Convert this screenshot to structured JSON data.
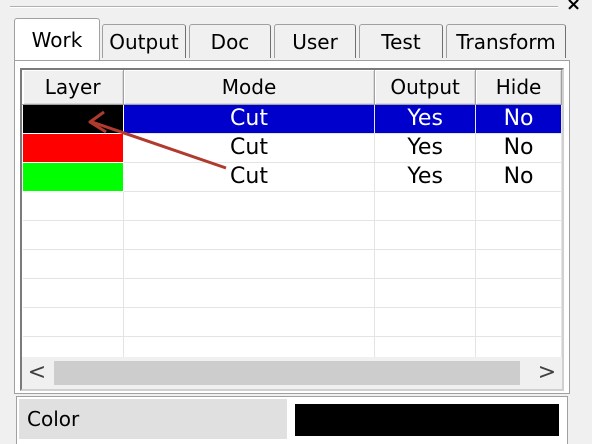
{
  "window": {
    "close_glyph": "×"
  },
  "tabs": [
    {
      "label": "Work",
      "active": true
    },
    {
      "label": "Output",
      "active": false
    },
    {
      "label": "Doc",
      "active": false
    },
    {
      "label": "User",
      "active": false
    },
    {
      "label": "Test",
      "active": false
    },
    {
      "label": "Transform",
      "active": false
    }
  ],
  "layers_table": {
    "headers": {
      "layer": "Layer",
      "mode": "Mode",
      "output": "Output",
      "hide": "Hide"
    },
    "rows": [
      {
        "color": "#000000",
        "mode": "Cut",
        "output": "Yes",
        "hide": "No",
        "selected": true
      },
      {
        "color": "#ff0000",
        "mode": "Cut",
        "output": "Yes",
        "hide": "No",
        "selected": false
      },
      {
        "color": "#00ff00",
        "mode": "Cut",
        "output": "Yes",
        "hide": "No",
        "selected": false
      }
    ]
  },
  "scrollbar": {
    "left_glyph": "<",
    "right_glyph": ">"
  },
  "properties": {
    "label": "Color",
    "value_color": "#000000"
  },
  "colors": {
    "selection": "#0000cc",
    "annotation_arrow": "#b03a2e"
  }
}
